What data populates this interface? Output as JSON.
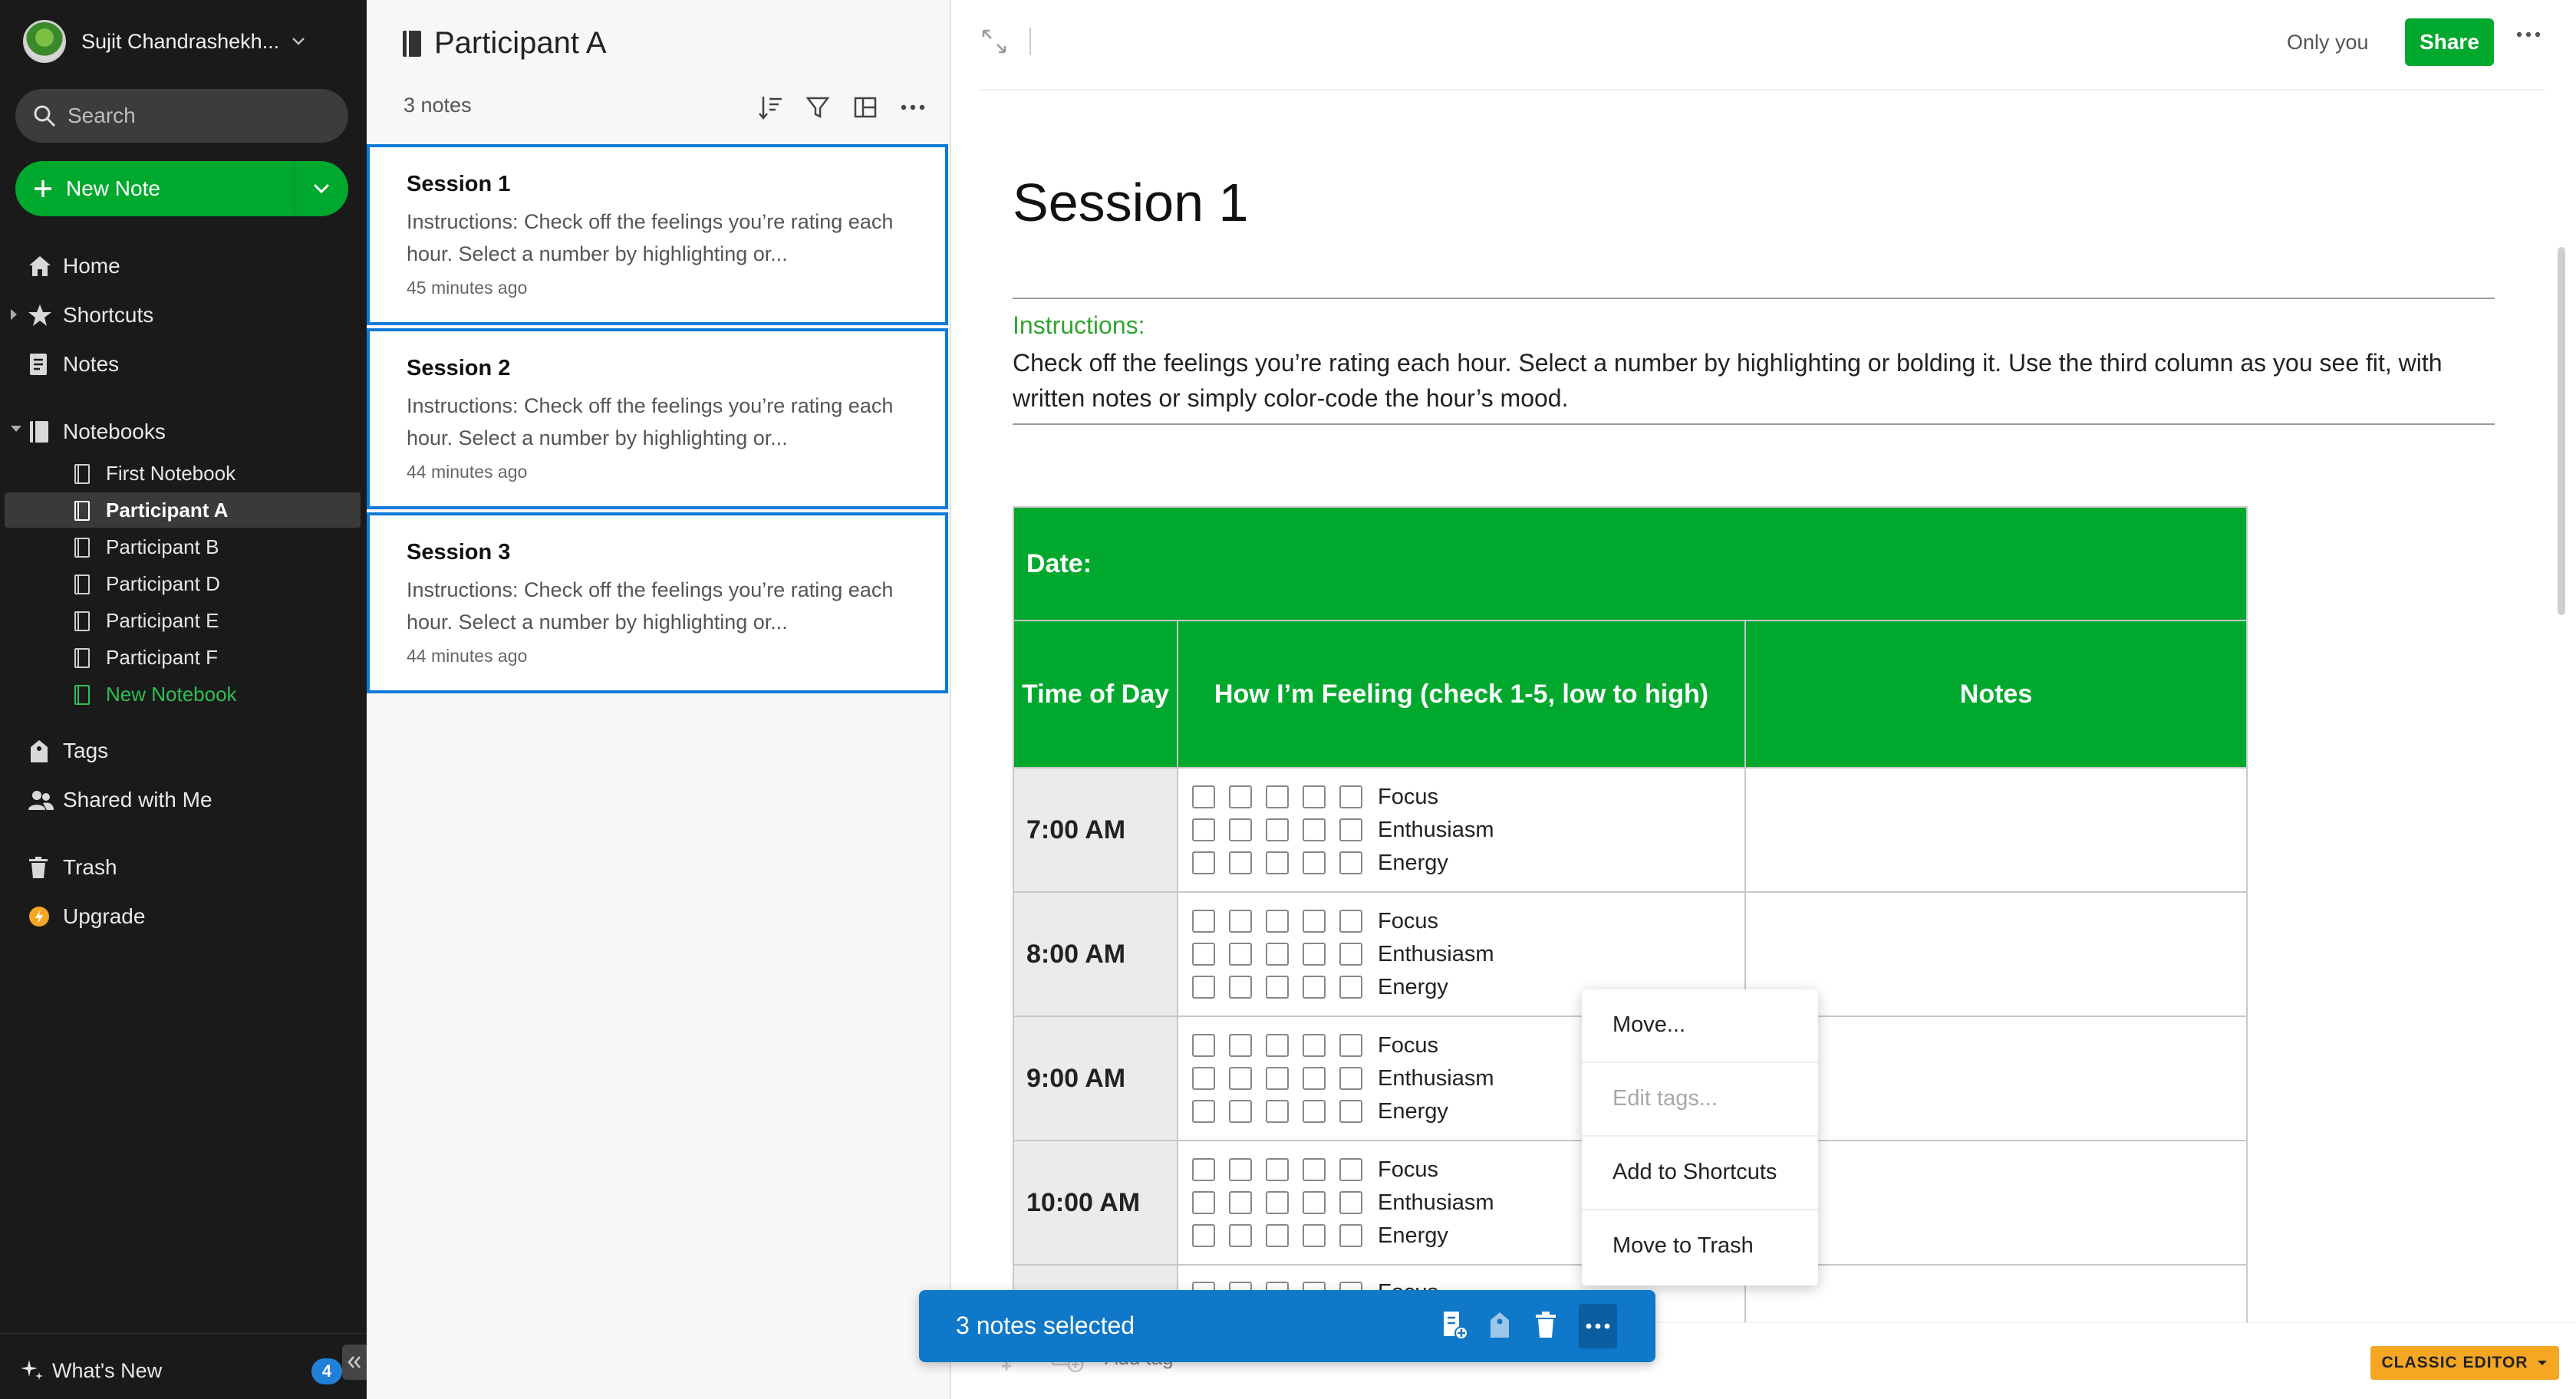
{
  "account": {
    "name": "Sujit Chandrashekh..."
  },
  "search": {
    "placeholder": "Search"
  },
  "new_note": {
    "label": "New Note"
  },
  "nav": {
    "home": "Home",
    "shortcuts": "Shortcuts",
    "notes": "Notes",
    "notebooks": "Notebooks",
    "tags": "Tags",
    "shared": "Shared with Me",
    "trash": "Trash",
    "upgrade": "Upgrade"
  },
  "notebooks": [
    {
      "label": "First Notebook",
      "active": false
    },
    {
      "label": "Participant A",
      "active": true
    },
    {
      "label": "Participant B",
      "active": false
    },
    {
      "label": "Participant D",
      "active": false
    },
    {
      "label": "Participant E",
      "active": false
    },
    {
      "label": "Participant F",
      "active": false
    },
    {
      "label": "New Notebook",
      "active": false
    }
  ],
  "whats_new": {
    "label": "What's New",
    "badge": "4"
  },
  "note_list": {
    "title": "Participant A",
    "count": "3 notes",
    "notes": [
      {
        "title": "Session 1",
        "snippet": "Instructions: Check off the feelings you’re rating each hour. Select a number by highlighting or...",
        "time": "45 minutes ago"
      },
      {
        "title": "Session 2",
        "snippet": "Instructions: Check off the feelings you’re rating each hour. Select a number by highlighting or...",
        "time": "44 minutes ago"
      },
      {
        "title": "Session 3",
        "snippet": "Instructions: Check off the feelings you’re rating each hour. Select a number by highlighting or...",
        "time": "44 minutes ago"
      }
    ]
  },
  "editor": {
    "visibility": "Only you",
    "share_label": "Share",
    "title": "Session 1",
    "instructions_label": "Instructions:",
    "instructions_text": "Check off the feelings you’re rating each hour. Select a number by highlighting or bolding it. Use the third column as you see fit, with written notes or simply color-code the hour’s mood.",
    "table": {
      "date_label": "Date:",
      "headers": [
        "Time of Day",
        "How I’m Feeling (check 1-5, low to high)",
        "Notes"
      ],
      "feelings": [
        "Focus",
        "Enthusiasm",
        "Energy"
      ],
      "rows": [
        "7:00 AM",
        "8:00 AM",
        "9:00 AM",
        "10:00 AM"
      ],
      "partial_feeling": "Focus"
    },
    "add_tag": "Add tag",
    "classic_editor": "CLASSIC EDITOR"
  },
  "context_menu": {
    "items": [
      {
        "label": "Move...",
        "disabled": false
      },
      {
        "label": "Edit tags...",
        "disabled": true
      },
      {
        "label": "Add to Shortcuts",
        "disabled": false
      },
      {
        "label": "Move to Trash",
        "disabled": false
      }
    ]
  },
  "selection_bar": {
    "label": "3 notes selected"
  },
  "colors": {
    "brand_green": "#00a82d",
    "selection_blue": "#0f78c8",
    "sidebar_bg": "#1a1a1a",
    "accent_orange": "#f5a623"
  }
}
